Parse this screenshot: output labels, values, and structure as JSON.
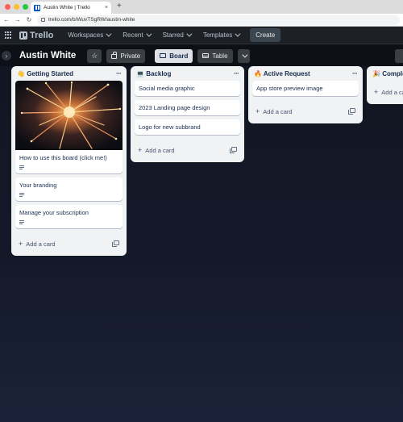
{
  "browser": {
    "tab_title": "Austin White | Trello",
    "tab_close": "×",
    "new_tab": "+",
    "url": "trello.com/b/WuvTSgRW/austin-white",
    "traffic_colors": [
      "#ff5f57",
      "#febc2e",
      "#28c840"
    ]
  },
  "header": {
    "logo": "Trello",
    "menus": [
      "Workspaces",
      "Recent",
      "Starred",
      "Templates"
    ],
    "create": "Create"
  },
  "board": {
    "title": "Austin White",
    "visibility": "Private",
    "view_board": "Board",
    "view_table": "Table"
  },
  "lists": [
    {
      "emoji": "👋",
      "title": "Getting Started",
      "cards": [
        {
          "title": "How to use this board (click me!)",
          "has_description": true,
          "has_cover": true
        },
        {
          "title": "Your branding",
          "has_description": true
        },
        {
          "title": "Manage your subscription",
          "has_description": true
        }
      ],
      "add_card": "Add a card"
    },
    {
      "emoji": "💻",
      "title": "Backlog",
      "cards": [
        {
          "title": "Social media graphic"
        },
        {
          "title": "2023 Landing page design"
        },
        {
          "title": "Logo for new subbrand"
        }
      ],
      "add_card": "Add a card"
    },
    {
      "emoji": "🔥",
      "title": "Active Request",
      "cards": [
        {
          "title": "App store preview image"
        }
      ],
      "add_card": "Add a card"
    },
    {
      "emoji": "🎉",
      "title": "Complete",
      "cards": [],
      "add_card": "Add a card"
    }
  ],
  "icons": {
    "star": "star-icon",
    "lock": "lock-icon",
    "board": "board-icon",
    "table": "table-icon",
    "more": "more-horizontal-icon",
    "add": "plus-icon",
    "template": "card-template-icon",
    "description": "description-icon"
  },
  "colors": {
    "header_bg": "#1d2125",
    "list_bg": "#f1f2f4",
    "card_bg": "#ffffff",
    "board_bg": "#121622"
  }
}
